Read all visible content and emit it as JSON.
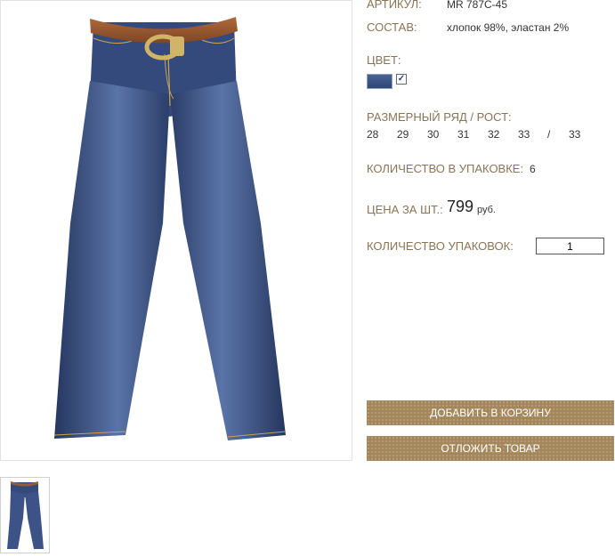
{
  "product": {
    "article_label": "АРТИКУЛ:",
    "article_value": "MR 787C-45",
    "composition_label": "СОСТАВ:",
    "composition_value": "хлопок 98%, эластан 2%",
    "color_label": "ЦВЕТ:",
    "color_swatch": "#3b5288",
    "color_selected_mark": "✓",
    "size_label": "РАЗМЕРНЫЙ РЯД / РОСТ:",
    "sizes": [
      "28",
      "29",
      "30",
      "31",
      "32",
      "33",
      "/",
      "33"
    ],
    "pack_qty_label": "КОЛИЧЕСТВО В УПАКОВКЕ:",
    "pack_qty_value": "6",
    "price_label": "ЦЕНА ЗА ШТ.:",
    "price_value": "799",
    "price_unit": "руб.",
    "packs_label": "КОЛИЧЕСТВО УПАКОВОК:",
    "packs_value": "1"
  },
  "buttons": {
    "add_to_cart": "ДОБАВИТЬ В КОРЗИНУ",
    "postpone": "ОТЛОЖИТЬ ТОВАР"
  },
  "colors": {
    "label": "#8b7355",
    "button": "#a4865b",
    "denim": "#34497c",
    "belt": "#9a5a32"
  }
}
